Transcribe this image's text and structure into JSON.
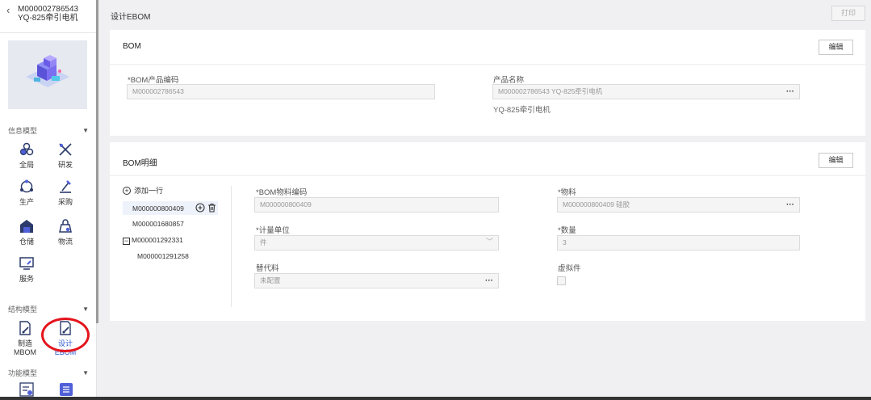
{
  "sidebar": {
    "back_icon": "chevron-left-icon",
    "title_line1": "M000002786543",
    "title_line2": "YQ-825牵引电机",
    "section_info": "信息模型",
    "section_structure": "结构模型",
    "section_function": "功能模型",
    "info_items": [
      {
        "label": "全局",
        "icon": "global-icon"
      },
      {
        "label": "研发",
        "icon": "research-icon"
      },
      {
        "label": "生产",
        "icon": "production-icon"
      },
      {
        "label": "采购",
        "icon": "purchase-icon"
      },
      {
        "label": "仓储",
        "icon": "warehouse-icon"
      },
      {
        "label": "物流",
        "icon": "logistics-icon"
      },
      {
        "label": "服务",
        "icon": "service-icon"
      }
    ],
    "structure_items": [
      {
        "label": "制造MBOM",
        "icon": "mbom-icon"
      },
      {
        "label": "设计EBOM",
        "icon": "ebom-icon",
        "active": true
      }
    ]
  },
  "header": {
    "title": "设计EBOM",
    "print_label": "打印"
  },
  "bom": {
    "title": "BOM",
    "edit_label": "编辑",
    "code_label": "*BOM产品编码",
    "code_value": "M000002786543",
    "name_label": "产品名称",
    "name_value": "M000002786543 YQ-825牵引电机",
    "name_subtext": "YQ-825牵引电机"
  },
  "detail": {
    "title": "BOM明细",
    "edit_label": "编辑",
    "add_row_label": "添加一行",
    "tree": [
      {
        "label": "M000000800409",
        "selected": true
      },
      {
        "label": "M000001680857"
      },
      {
        "label": "M000001292331",
        "expanded": true
      },
      {
        "label": "M000001291258",
        "child": true
      }
    ],
    "material_code_label": "*BOM物料编码",
    "material_code_value": "M000000800409",
    "material_label": "*物料",
    "material_value": "M000000800409 硅胶",
    "unit_label": "*计量单位",
    "unit_value": "件",
    "qty_label": "*数量",
    "qty_value": "3",
    "substitute_label": "替代料",
    "substitute_value": "未配置",
    "virtual_label": "虚拟件"
  },
  "colors": {
    "accent": "#2f5bd0",
    "highlight_circle": "#e4141c"
  }
}
